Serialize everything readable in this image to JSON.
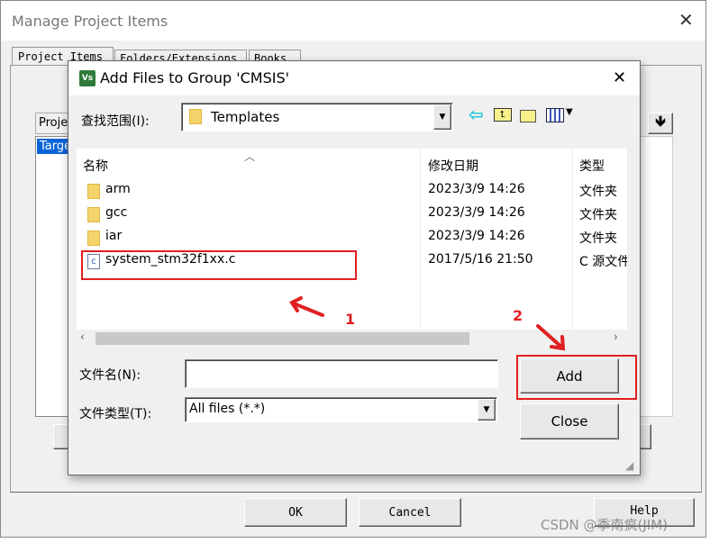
{
  "outer": {
    "title": "Manage Project Items",
    "tabs": [
      "Project Items",
      "Folders/Extensions",
      "Books"
    ],
    "groups_header": "Projec",
    "target_item": "Targe",
    "ok": "OK",
    "cancel": "Cancel",
    "help": "Help"
  },
  "dialog": {
    "title": "Add Files to Group 'CMSIS'",
    "look_in_label": "查找范围(I):",
    "look_in_value": "Templates",
    "columns": [
      "名称",
      "修改日期",
      "类型"
    ],
    "files": [
      {
        "name": "arm",
        "date": "2023/3/9 14:26",
        "type": "文件夹",
        "icon": "folder-icon"
      },
      {
        "name": "gcc",
        "date": "2023/3/9 14:26",
        "type": "文件夹",
        "icon": "folder-icon"
      },
      {
        "name": "iar",
        "date": "2023/3/9 14:26",
        "type": "文件夹",
        "icon": "folder-icon"
      },
      {
        "name": "system_stm32f1xx.c",
        "date": "2017/5/16 21:50",
        "type": "C 源文件",
        "icon": "c-file-icon"
      }
    ],
    "filename_label": "文件名(N):",
    "filename_value": "",
    "filetype_label": "文件类型(T):",
    "filetype_value": "All files (*.*)",
    "add": "Add",
    "close": "Close"
  },
  "annotations": {
    "step1": "1",
    "step2": "2",
    "color": "#e02020"
  },
  "watermark": "CSDN @季南疯(JIM)"
}
